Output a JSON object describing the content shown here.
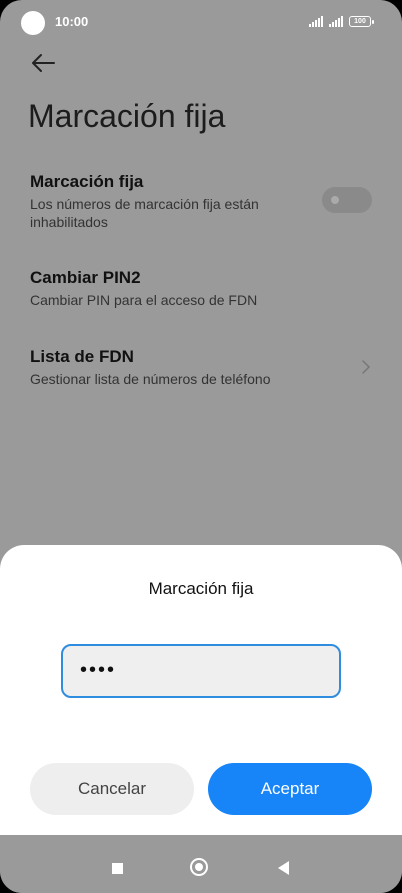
{
  "status_bar": {
    "time": "10:00",
    "battery": "100"
  },
  "page": {
    "title": "Marcación fija"
  },
  "settings": [
    {
      "title": "Marcación fija",
      "subtitle": "Los números de marcación fija están inhabilitados",
      "control": "toggle",
      "enabled": false
    },
    {
      "title": "Cambiar PIN2",
      "subtitle": "Cambiar PIN para el acceso de FDN"
    },
    {
      "title": "Lista de FDN",
      "subtitle": "Gestionar lista de números de teléfono",
      "control": "chevron"
    }
  ],
  "dialog": {
    "title": "Marcación fija",
    "pin_value": "••••",
    "cancel_label": "Cancelar",
    "ok_label": "Aceptar"
  },
  "colors": {
    "accent": "#1784f8",
    "input_border": "#2f8de0",
    "scrim": "#9a9a9a"
  },
  "icons": {
    "back": "arrow-left-icon",
    "chevron": "chevron-right-icon",
    "nav_recents": "square-icon",
    "nav_home": "circle-icon",
    "nav_back": "triangle-icon"
  }
}
